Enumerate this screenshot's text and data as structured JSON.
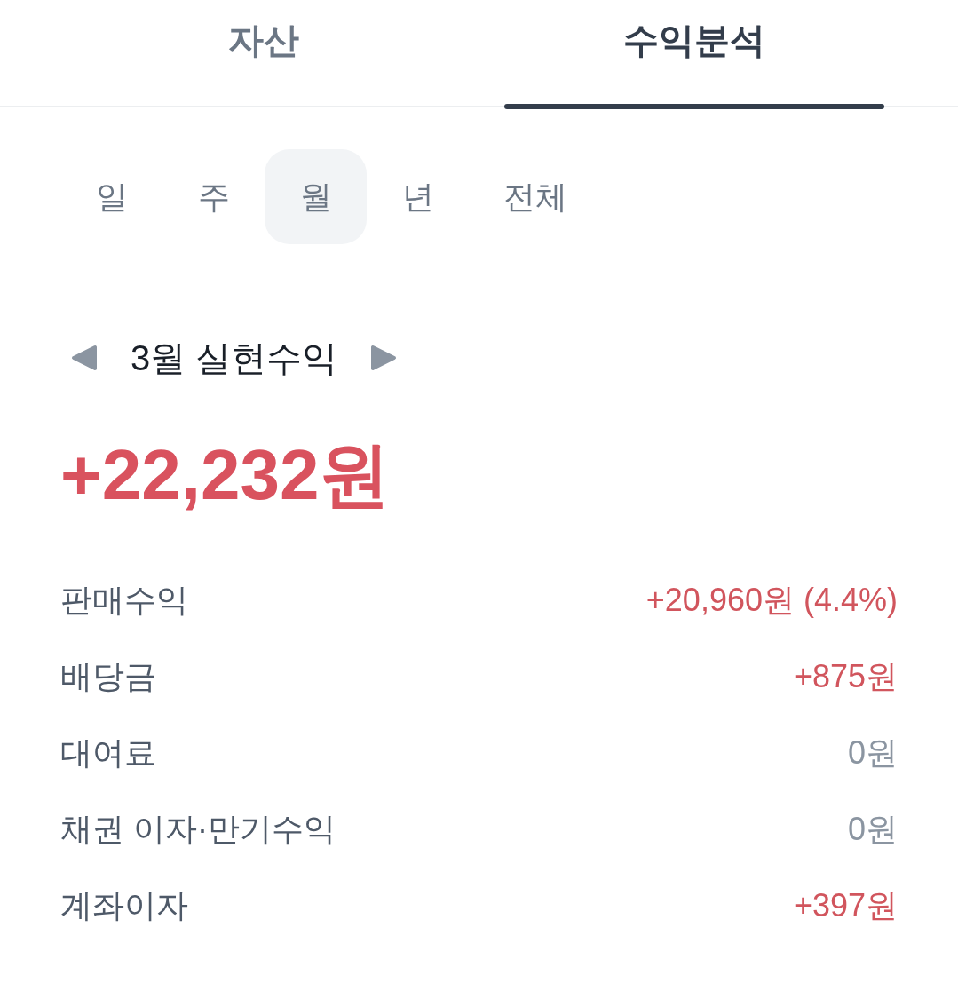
{
  "tabs": [
    {
      "label": "자산",
      "selected": false
    },
    {
      "label": "수익분석",
      "selected": true
    }
  ],
  "periods": [
    {
      "label": "일",
      "selected": false
    },
    {
      "label": "주",
      "selected": false
    },
    {
      "label": "월",
      "selected": true
    },
    {
      "label": "년",
      "selected": false
    },
    {
      "label": "전체",
      "selected": false
    }
  ],
  "summary": {
    "title": "3월 실현수익",
    "amount": "+22,232원"
  },
  "rows": [
    {
      "label": "판매수익",
      "value": "+20,960원 (4.4%)",
      "color": "#d1555d"
    },
    {
      "label": "배당금",
      "value": "+875원",
      "color": "#d1555d"
    },
    {
      "label": "대여료",
      "value": "0원",
      "color": "#8b95a1"
    },
    {
      "label": "채권 이자·만기수익",
      "value": "0원",
      "color": "#8b95a1"
    },
    {
      "label": "계좌이자",
      "value": "+397원",
      "color": "#d1555d"
    }
  ]
}
